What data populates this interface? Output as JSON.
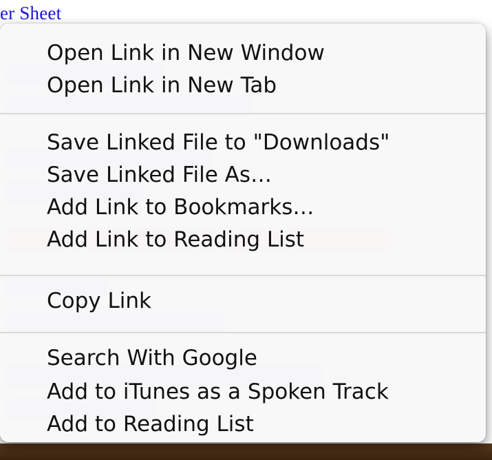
{
  "background_page": {
    "partial_link_text": "er Sheet",
    "link_color": "#1a14d6"
  },
  "context_menu": {
    "groups": [
      {
        "items": [
          {
            "label": "Open Link in New Window"
          },
          {
            "label": "Open Link in New Tab"
          }
        ]
      },
      {
        "items": [
          {
            "label": "Save Linked File to \"Downloads\""
          },
          {
            "label": "Save Linked File As…"
          },
          {
            "label": "Add Link to Bookmarks…"
          },
          {
            "label": "Add Link to Reading List"
          }
        ]
      },
      {
        "items": [
          {
            "label": "Copy Link"
          }
        ]
      },
      {
        "items": [
          {
            "label": "Search With Google"
          },
          {
            "label": "Add to iTunes as a Spoken Track"
          },
          {
            "label": "Add to Reading List"
          }
        ]
      }
    ]
  }
}
